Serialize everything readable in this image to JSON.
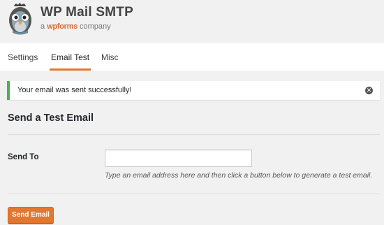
{
  "header": {
    "title": "WP Mail SMTP",
    "sub_prefix": "a",
    "sub_brand": "wpforms",
    "sub_suffix": "company",
    "logo_icon": "pigeon-mascot-icon"
  },
  "tabs": [
    {
      "label": "Settings",
      "active": false
    },
    {
      "label": "Email Test",
      "active": true
    },
    {
      "label": "Misc",
      "active": false
    }
  ],
  "notice": {
    "text": "Your email was sent successfully!",
    "status_color": "#46b450",
    "dismiss_icon": "dismiss-icon"
  },
  "form": {
    "section_title": "Send a Test Email",
    "send_to_label": "Send To",
    "send_to_value": "",
    "help_text": "Type an email address here and then click a button below to generate a test email.",
    "button_label": "Send Email"
  },
  "colors": {
    "accent": "#e27730",
    "background": "#f1f1f1"
  }
}
